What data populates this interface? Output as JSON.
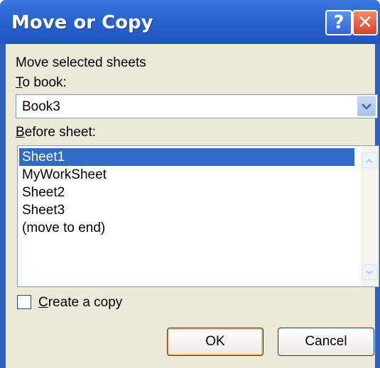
{
  "window": {
    "title": "Move or Copy",
    "help_label": "?",
    "close_label": "✕"
  },
  "dialog": {
    "description": "Move selected sheets",
    "to_book": {
      "label_accel": "T",
      "label_rest": "o book:",
      "value": "Book3"
    },
    "before_sheet": {
      "label_accel": "B",
      "label_rest": "efore sheet:",
      "items": [
        "Sheet1",
        "MyWorkSheet",
        "Sheet2",
        "Sheet3",
        "(move to end)"
      ],
      "selected": "Sheet1"
    },
    "create_copy": {
      "label_accel": "C",
      "label_rest": "reate a copy",
      "checked": false
    },
    "buttons": {
      "ok": "OK",
      "cancel": "Cancel"
    }
  },
  "colors": {
    "titlebar": "#2a63cf",
    "selection": "#316ac5",
    "client_bg": "#ece9d8"
  }
}
